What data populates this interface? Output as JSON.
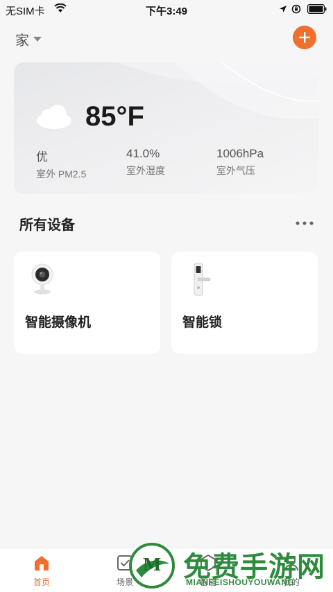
{
  "status_bar": {
    "carrier": "无SIM卡",
    "time": "下午3:49"
  },
  "header": {
    "home_name": "家"
  },
  "weather": {
    "temperature": "85°F",
    "stats": [
      {
        "value": "优",
        "label": "室外 PM2.5"
      },
      {
        "value": "41.0%",
        "label": "室外湿度"
      },
      {
        "value": "1006hPa",
        "label": "室外气压"
      }
    ]
  },
  "devices": {
    "title": "所有设备",
    "items": [
      {
        "name": "智能摄像机",
        "icon": "camera-icon"
      },
      {
        "name": "智能锁",
        "icon": "smart-lock-icon"
      }
    ]
  },
  "tabs": [
    {
      "label": "首页",
      "icon": "home-icon",
      "active": true
    },
    {
      "label": "场景",
      "icon": "scene-icon"
    },
    {
      "label": "智能",
      "icon": "smart-icon"
    },
    {
      "label": "我的",
      "icon": "profile-icon"
    }
  ],
  "watermark": {
    "title": "免费手游网",
    "subtitle": "MIANFEISHOUYOUWANG",
    "logo_letter": "M"
  },
  "colors": {
    "accent": "#ef6f2e",
    "background": "#f6f6f6",
    "watermark_green": "#2e8b3d"
  }
}
